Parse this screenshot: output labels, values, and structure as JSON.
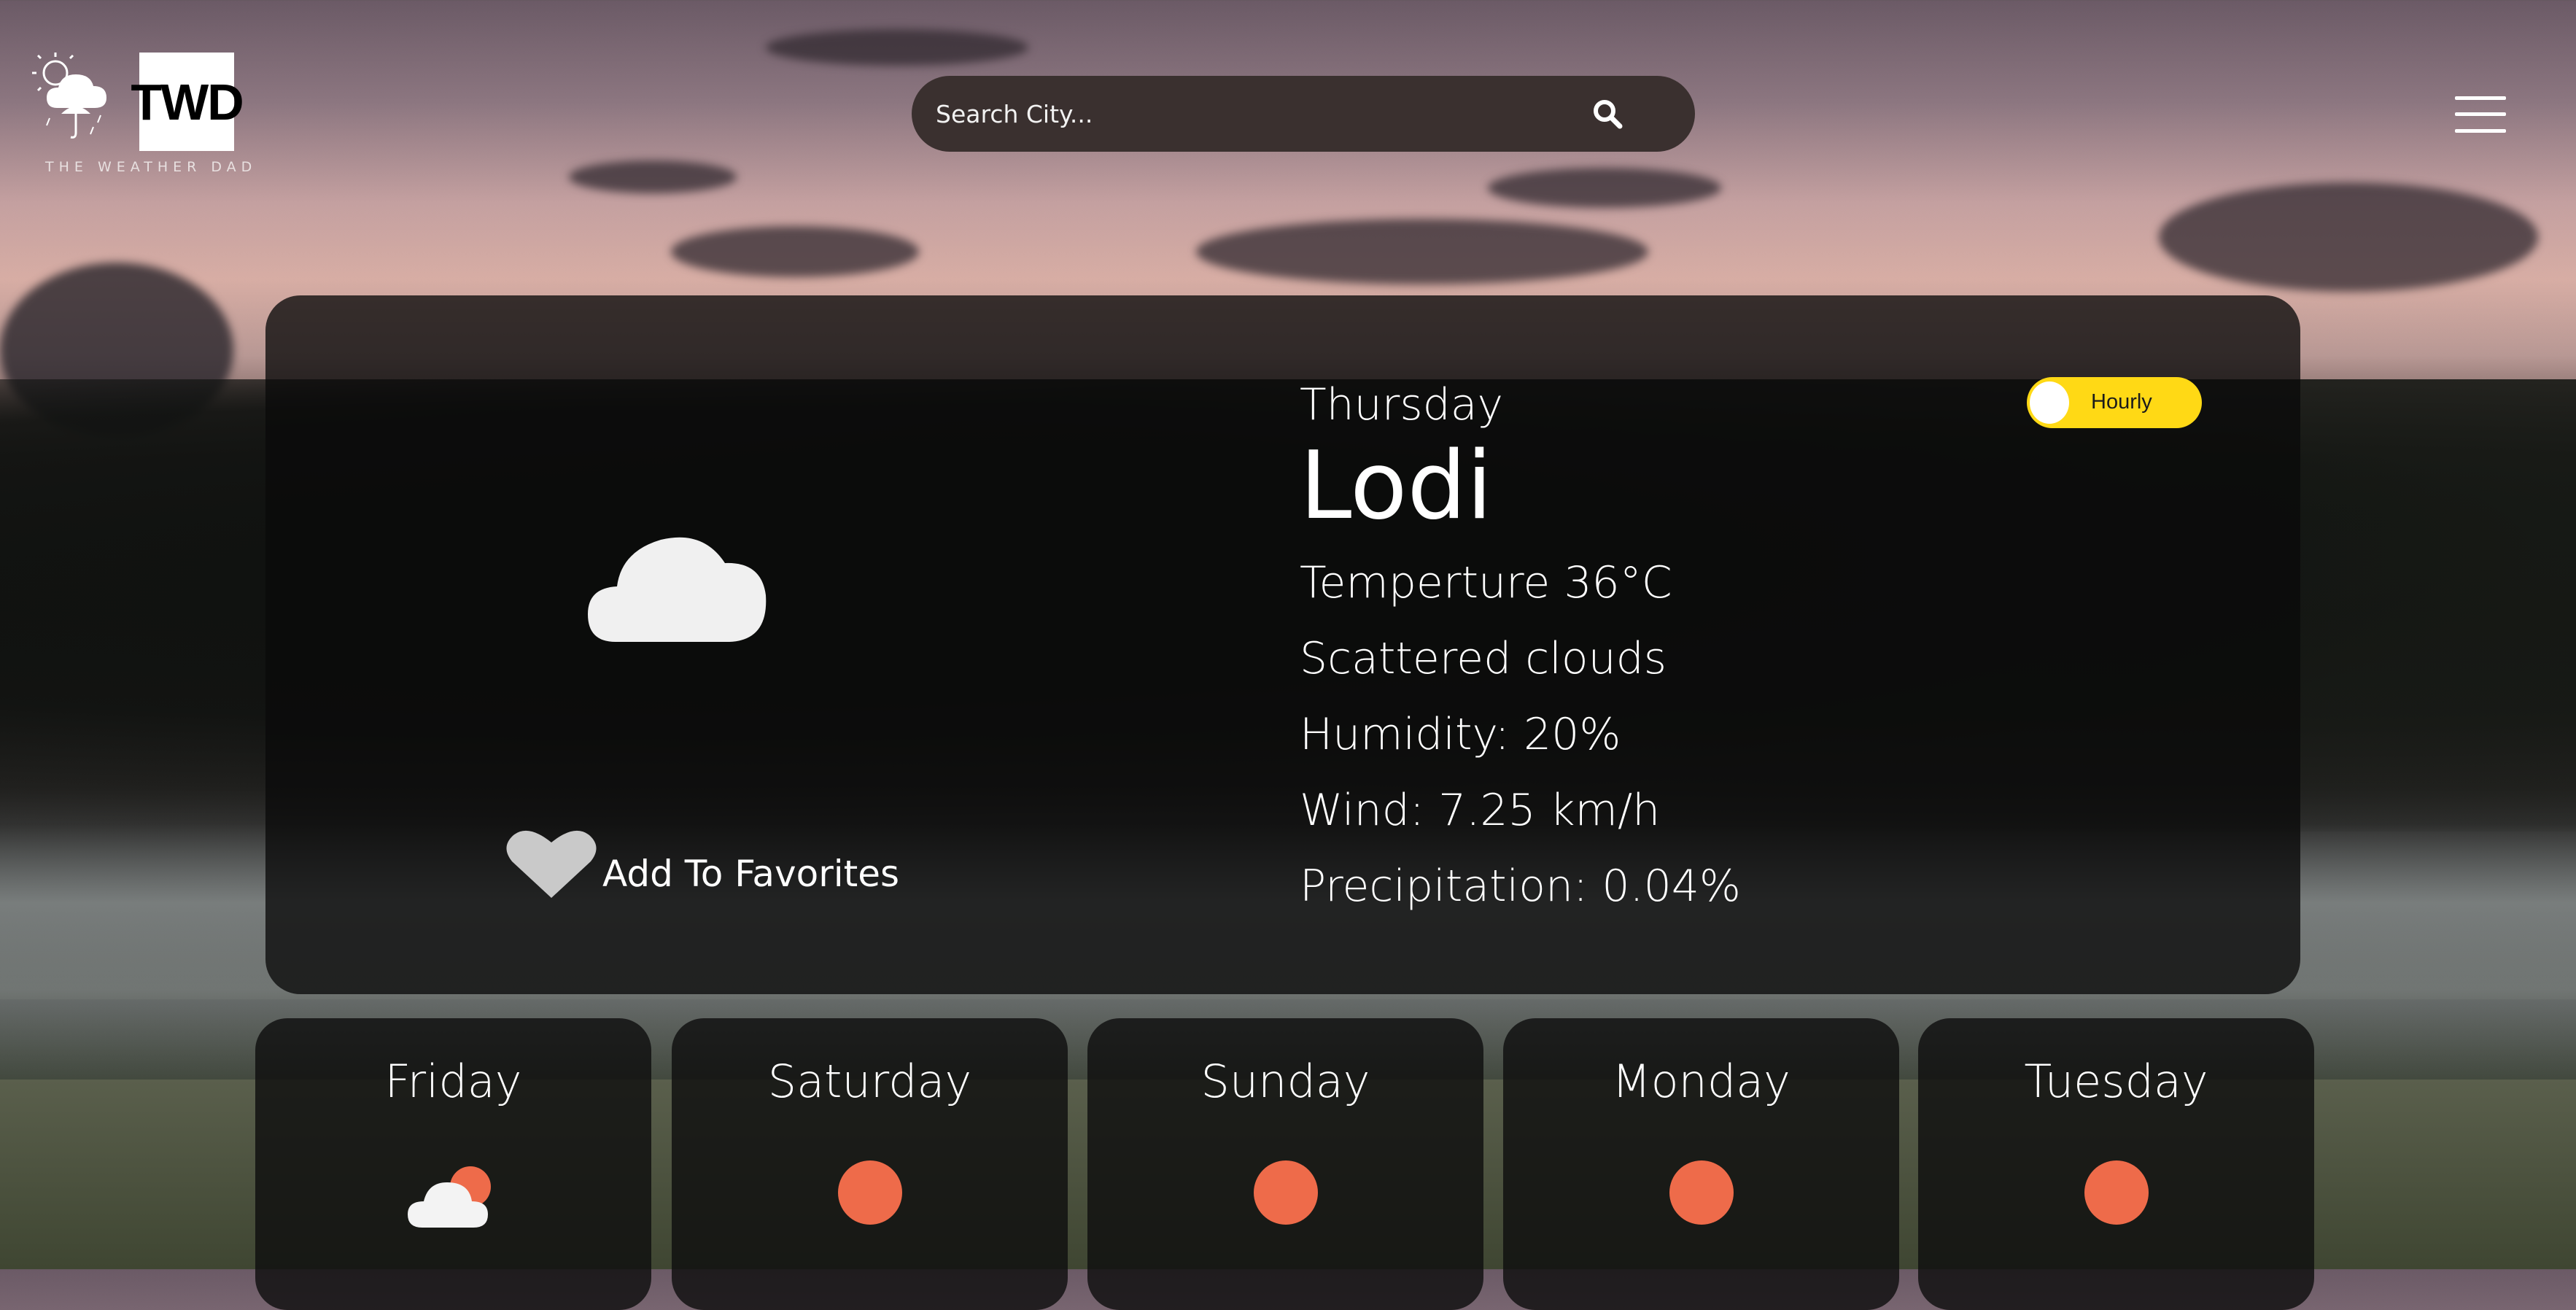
{
  "header": {
    "logo_text": "TWD",
    "logo_tagline": "THE WEATHER DAD",
    "search_placeholder": "Search City..."
  },
  "current": {
    "day": "Thursday",
    "city": "Lodi",
    "temperature": "Temperture 36°C",
    "condition": "Scattered clouds",
    "humidity": "Humidity: 20%",
    "wind": "Wind: 7.25 km/h",
    "precipitation": "Precipitation: 0.04%",
    "toggle_label": "Hourly",
    "favorites_label": "Add To Favorites",
    "icon": "cloud-icon"
  },
  "forecast": [
    {
      "day": "Friday",
      "icon": "sun-behind-cloud-icon"
    },
    {
      "day": "Saturday",
      "icon": "sun-icon"
    },
    {
      "day": "Sunday",
      "icon": "sun-icon"
    },
    {
      "day": "Monday",
      "icon": "sun-icon"
    },
    {
      "day": "Tuesday",
      "icon": "sun-icon"
    }
  ],
  "colors": {
    "toggle": "#ffd915",
    "sun": "#ee6b4a",
    "card": "#0a0a0a",
    "search": "#3a302f"
  }
}
